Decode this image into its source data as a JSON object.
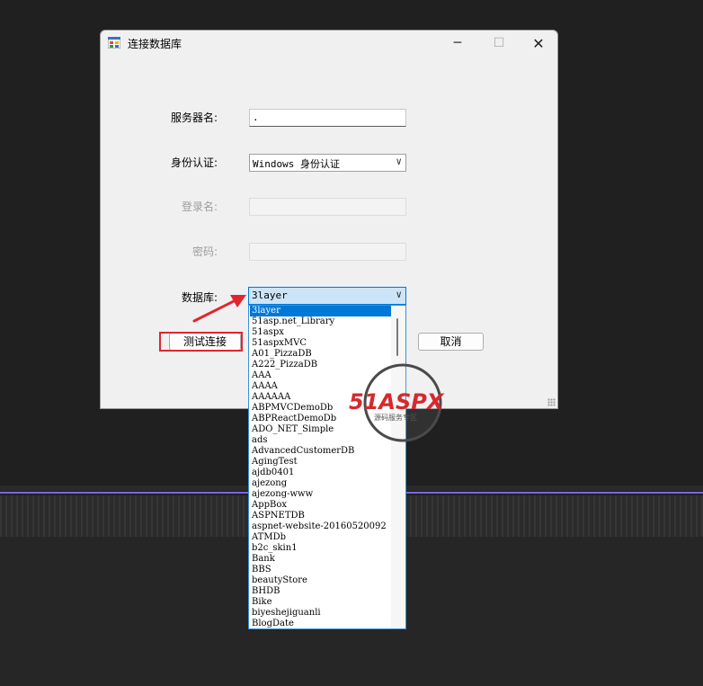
{
  "window": {
    "title": "连接数据库",
    "min_glyph": "─",
    "max_glyph": "☐",
    "close_glyph": "✕"
  },
  "form": {
    "server_label": "服务器名:",
    "server_value": ".",
    "auth_label": "身份认证:",
    "auth_value": "Windows 身份认证",
    "login_label": "登录名:",
    "login_value": "",
    "password_label": "密码:",
    "password_value": "",
    "database_label": "数据库:",
    "database_value": "3layer",
    "test_button": "测试连接",
    "cancel_button": "取消"
  },
  "database_options": [
    "3layer",
    "51asp.net_Library",
    "51aspx",
    "51aspxMVC",
    "A01_PizzaDB",
    "A222_PizzaDB",
    "AAA",
    "AAAA",
    "AAAAAA",
    "ABPMVCDemoDb",
    "ABPReactDemoDb",
    "ADO_NET_Simple",
    "ads",
    "AdvancedCustomerDB",
    "AgingTest",
    "ajdb0401",
    "ajezong",
    "ajezong-www",
    "AppBox",
    "ASPNETDB",
    "aspnet-website-20160520092",
    "ATMDb",
    "b2c_skin1",
    "Bank",
    "BBS",
    "beautyStore",
    "BHDB",
    "Bike",
    "biyeshejiguanli",
    "BlogDate"
  ],
  "selected_index": 0,
  "watermark": {
    "brand": "51ASPX",
    "tagline": "源码服务专区"
  },
  "colors": {
    "accent": "#0078d7",
    "annotation_red": "#e0262e",
    "window_bg": "#f0f0f0",
    "desktop_bg": "#202020"
  }
}
